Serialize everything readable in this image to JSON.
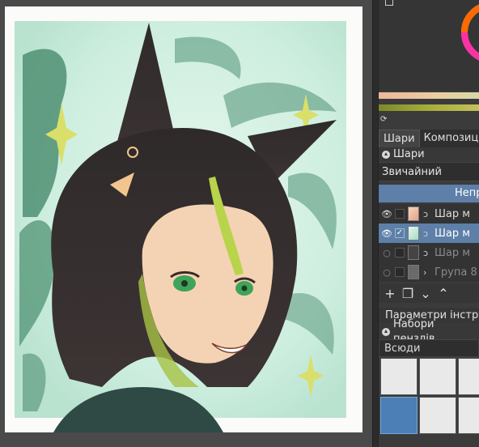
{
  "tabs": [
    "Шари",
    "Композиці"
  ],
  "layers_panel": {
    "title": "Шари"
  },
  "blend_mode": "Звичайний",
  "opacity_label": "Непр",
  "layers": [
    {
      "name": "Шар м",
      "visible": true,
      "checked": false,
      "active": false,
      "dim": false
    },
    {
      "name": "Шар м",
      "visible": true,
      "checked": true,
      "active": true,
      "dim": false
    },
    {
      "name": "Шар м",
      "visible": false,
      "checked": false,
      "active": false,
      "dim": true
    },
    {
      "name": "Група 8",
      "visible": false,
      "checked": false,
      "active": false,
      "dim": true
    }
  ],
  "tool_options": "Параметри інструм",
  "brush_sets": {
    "title": "Набори пензлів"
  },
  "brush_filter": "Всюди",
  "icons": {
    "eye": "eye-icon",
    "add": "add-layer-icon",
    "duplicate": "duplicate-icon",
    "down": "move-down-icon",
    "up": "move-up-icon",
    "refresh": "refresh-icon"
  },
  "colors": {
    "accent": "#5d7fa8",
    "panel_bg": "#3b3b3b"
  }
}
